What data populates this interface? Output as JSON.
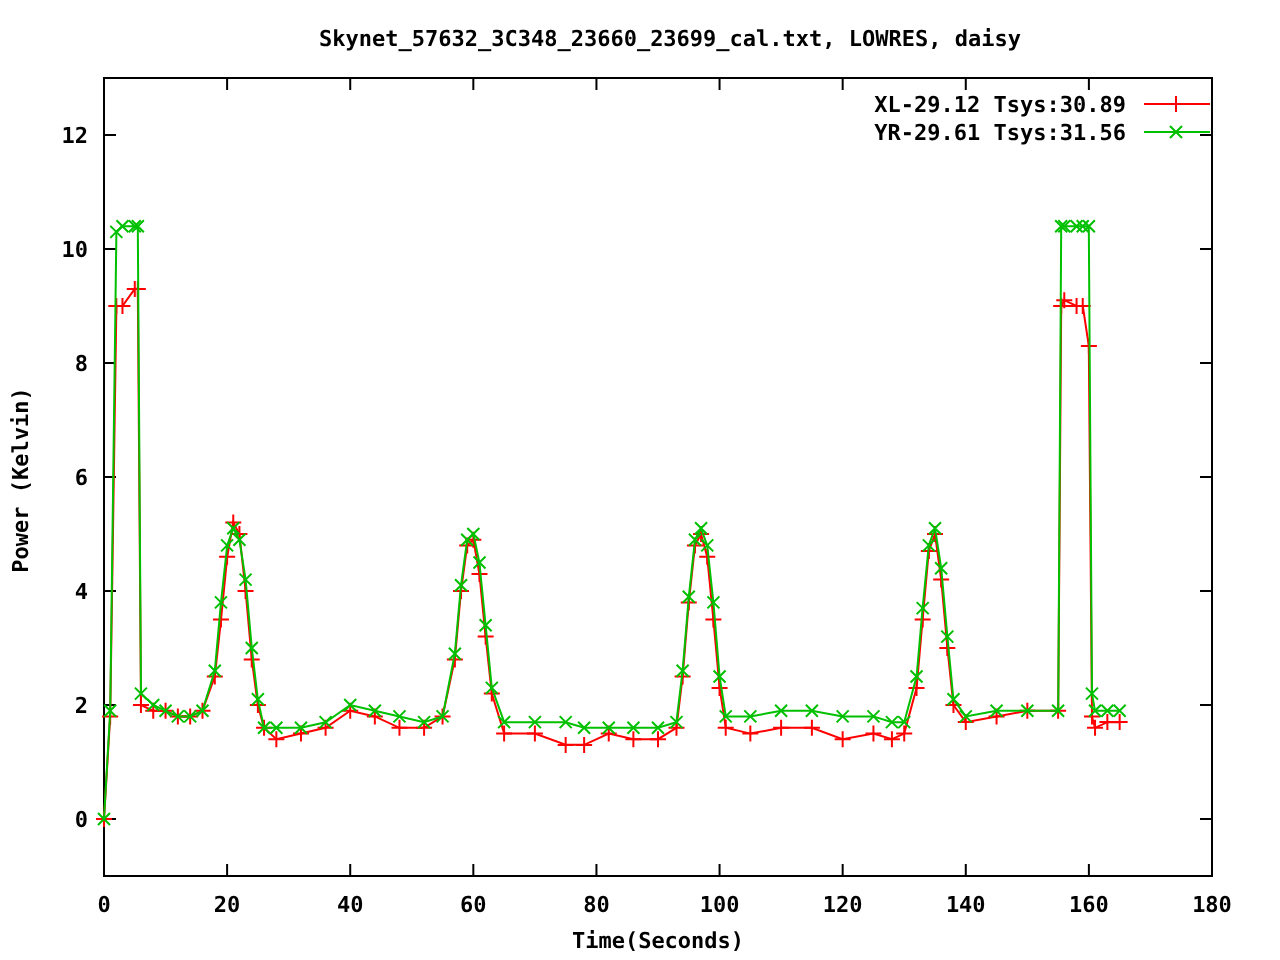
{
  "chart_data": {
    "type": "line",
    "title": "Skynet_57632_3C348_23660_23699_cal.txt, LOWRES, daisy",
    "xlabel": "Time(Seconds)",
    "ylabel": "Power (Kelvin)",
    "x": [
      0,
      1,
      2,
      3,
      5,
      5.5,
      6,
      8,
      10,
      12,
      14,
      16,
      18,
      19,
      20,
      21,
      22,
      23,
      24,
      25,
      26,
      28,
      32,
      36,
      40,
      44,
      48,
      52,
      55,
      57,
      58,
      59,
      60,
      61,
      62,
      63,
      65,
      70,
      75,
      78,
      82,
      86,
      90,
      93,
      94,
      95,
      96,
      97,
      98,
      99,
      100,
      101,
      105,
      110,
      115,
      120,
      125,
      128,
      130,
      132,
      133,
      134,
      135,
      136,
      137,
      138,
      140,
      145,
      150,
      155,
      155.5,
      156,
      158,
      159,
      160,
      160.5,
      161,
      163,
      165
    ],
    "series": [
      {
        "name": "XL-29.12 Tsys:30.89",
        "color": "#ff0000",
        "marker": "plus",
        "values": [
          0,
          1.8,
          9.0,
          9.0,
          9.3,
          9.3,
          2.0,
          1.9,
          1.9,
          1.8,
          1.8,
          1.9,
          2.5,
          3.5,
          4.6,
          5.2,
          5.0,
          4.0,
          2.8,
          2.0,
          1.6,
          1.4,
          1.5,
          1.6,
          1.9,
          1.8,
          1.6,
          1.6,
          1.8,
          2.8,
          4.0,
          4.8,
          4.9,
          4.3,
          3.2,
          2.2,
          1.5,
          1.5,
          1.3,
          1.3,
          1.5,
          1.4,
          1.4,
          1.6,
          2.5,
          3.8,
          4.8,
          5.0,
          4.6,
          3.5,
          2.3,
          1.6,
          1.5,
          1.6,
          1.6,
          1.4,
          1.5,
          1.4,
          1.5,
          2.3,
          3.5,
          4.7,
          5.0,
          4.2,
          3.0,
          2.0,
          1.7,
          1.8,
          1.9,
          1.9,
          9.0,
          9.1,
          9.0,
          9.0,
          8.3,
          1.8,
          1.6,
          1.7,
          1.7
        ]
      },
      {
        "name": "YR-29.61 Tsys:31.56",
        "color": "#00c000",
        "marker": "cross",
        "values": [
          0,
          1.9,
          10.3,
          10.4,
          10.4,
          10.4,
          2.2,
          2.0,
          1.9,
          1.8,
          1.8,
          1.9,
          2.6,
          3.8,
          4.8,
          5.1,
          4.9,
          4.2,
          3.0,
          2.1,
          1.6,
          1.6,
          1.6,
          1.7,
          2.0,
          1.9,
          1.8,
          1.7,
          1.8,
          2.9,
          4.1,
          4.9,
          5.0,
          4.5,
          3.4,
          2.3,
          1.7,
          1.7,
          1.7,
          1.6,
          1.6,
          1.6,
          1.6,
          1.7,
          2.6,
          3.9,
          4.9,
          5.1,
          4.8,
          3.8,
          2.5,
          1.8,
          1.8,
          1.9,
          1.9,
          1.8,
          1.8,
          1.7,
          1.7,
          2.5,
          3.7,
          4.8,
          5.1,
          4.4,
          3.2,
          2.1,
          1.8,
          1.9,
          1.9,
          1.9,
          10.4,
          10.4,
          10.4,
          10.4,
          10.4,
          2.2,
          1.9,
          1.9,
          1.9
        ]
      }
    ],
    "legend": true,
    "xlim": [
      0,
      180
    ],
    "ylim": [
      -1,
      13
    ],
    "xticks": [
      0,
      20,
      40,
      60,
      80,
      100,
      120,
      140,
      160,
      180
    ],
    "yticks": [
      0,
      2,
      4,
      6,
      8,
      10,
      12
    ]
  }
}
